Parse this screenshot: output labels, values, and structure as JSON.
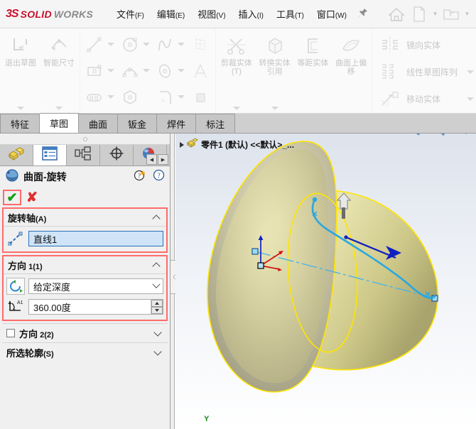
{
  "app": {
    "brand_3ds": "3S",
    "brand_solid": "SOLID",
    "brand_works": "WORKS",
    "accent_red": "#c8102e"
  },
  "menubar": {
    "items": [
      {
        "label": "文件",
        "mnemonic": "(F)",
        "name": "menu-file"
      },
      {
        "label": "编辑",
        "mnemonic": "(E)",
        "name": "menu-edit"
      },
      {
        "label": "视图",
        "mnemonic": "(V)",
        "name": "menu-view"
      },
      {
        "label": "插入",
        "mnemonic": "(I)",
        "name": "menu-insert"
      },
      {
        "label": "工具",
        "mnemonic": "(T)",
        "name": "menu-tools"
      },
      {
        "label": "窗口",
        "mnemonic": "(W)",
        "name": "menu-window"
      }
    ],
    "pin_icon": "pin-icon",
    "quick_access": [
      {
        "icon": "home-icon",
        "caret": false
      },
      {
        "icon": "new-document-icon",
        "caret": true
      },
      {
        "icon": "open-folder-icon",
        "caret": true
      },
      {
        "icon": "save-icon",
        "caret": false
      }
    ]
  },
  "ribbon": {
    "groups": [
      {
        "name": "sketch-exit-group",
        "big_buttons": [
          {
            "icon": "exit-sketch-icon",
            "label": "退出草图",
            "caret": true
          },
          {
            "icon": "smart-dimension-icon",
            "label": "智能尺寸",
            "caret": true
          }
        ]
      },
      {
        "name": "sketch-entities-group",
        "small_items": [
          {
            "icon": "line-icon",
            "caret": true
          },
          {
            "icon": "circle-icon",
            "caret": true
          },
          {
            "icon": "spline-icon",
            "caret": true
          },
          {
            "icon": "grid-snap-icon",
            "caret": false
          },
          {
            "icon": "rectangle-icon",
            "caret": true
          },
          {
            "icon": "arc-icon",
            "caret": true
          },
          {
            "icon": "ellipse-icon",
            "caret": true
          },
          {
            "icon": "text-icon",
            "caret": false
          },
          {
            "icon": "slot-icon",
            "caret": true
          },
          {
            "icon": "polygon-icon",
            "caret": false
          },
          {
            "icon": "sketch-fillet-icon",
            "caret": true
          },
          {
            "icon": "shaded-area-icon",
            "caret": false
          }
        ]
      },
      {
        "name": "sketch-tools-group",
        "big_buttons": [
          {
            "icon": "trim-entities-icon",
            "label": "剪裁实体(T)",
            "caret": true
          },
          {
            "icon": "convert-entities-icon",
            "label": "转换实体引用",
            "caret": true
          },
          {
            "icon": "offset-entities-icon",
            "label": "等距实体",
            "caret": false
          },
          {
            "icon": "offset-on-surface-icon",
            "label": "曲面上偏移",
            "caret": false
          }
        ]
      },
      {
        "name": "sketch-pattern-group",
        "list_items": [
          {
            "icon": "mirror-entities-icon",
            "label": "镜向实体",
            "caret": false
          },
          {
            "icon": "linear-sketch-pattern-icon",
            "label": "线性草图阵列",
            "caret": true
          },
          {
            "icon": "move-entities-icon",
            "label": "移动实体",
            "caret": true
          }
        ]
      }
    ]
  },
  "tabs": {
    "items": [
      {
        "label": "特征",
        "active": false,
        "name": "tab-features"
      },
      {
        "label": "草图",
        "active": true,
        "name": "tab-sketch"
      },
      {
        "label": "曲面",
        "active": false,
        "name": "tab-surfaces"
      },
      {
        "label": "钣金",
        "active": false,
        "name": "tab-sheetmetal"
      },
      {
        "label": "焊件",
        "active": false,
        "name": "tab-weldments"
      },
      {
        "label": "标注",
        "active": false,
        "name": "tab-annotation"
      }
    ]
  },
  "property_manager": {
    "panel_tabs": [
      {
        "icon": "feature-tree-icon",
        "active": false,
        "name": "panel-tab-feature-manager"
      },
      {
        "icon": "property-list-icon",
        "active": true,
        "name": "panel-tab-property-manager"
      },
      {
        "icon": "configuration-icon",
        "active": false,
        "name": "panel-tab-configuration-manager"
      },
      {
        "icon": "dimxpert-icon",
        "active": false,
        "name": "panel-tab-dimxpert"
      },
      {
        "icon": "appearances-sphere-icon",
        "active": false,
        "name": "panel-tab-appearances"
      }
    ],
    "nav_prev": "◀",
    "nav_next": "▶",
    "title": "曲面-旋转",
    "title_icon": "revolve-surface-icon",
    "help_whatsnew_icon": "help-whatsnew-icon",
    "help_icon": "help-icon",
    "confirm_icon": "check-icon",
    "cancel_icon": "x-icon",
    "groups": [
      {
        "name": "axis-of-revolution-group",
        "title": "旋转轴",
        "title_suffix": "(A)",
        "highlighted": true,
        "collapsed": false,
        "field_icon": "axis-line-icon",
        "field_value": "直线1"
      },
      {
        "name": "direction1-group",
        "title": "方向",
        "title_suffix": " 1(1)",
        "highlighted": true,
        "collapsed": false,
        "end_condition_icon": "revolve-direction-icon",
        "end_condition_value": "给定深度",
        "angle_icon": "angle-a1-icon",
        "angle_value": "360.00度"
      }
    ],
    "direction2": {
      "name": "direction2-group",
      "title": "方向",
      "title_suffix": " 2(2)",
      "checked": false,
      "collapsed": true
    },
    "selected_contours": {
      "name": "selected-contours-group",
      "title": "所选轮廓",
      "title_suffix": "(S)",
      "collapsed": true
    }
  },
  "graphics": {
    "tree_item": "零件1 (默认) <<默认>_...",
    "tree_icon": "part-icon",
    "view_tools": [
      {
        "icon": "zoom-to-fit-icon",
        "name": "zoom-to-fit-button"
      },
      {
        "icon": "zoom-to-area-icon",
        "name": "zoom-to-area-button"
      },
      {
        "icon": "section-view-icon",
        "name": "section-view-button"
      }
    ],
    "triad_label_y": "Y",
    "model": {
      "name": "revolved-bell-surface",
      "body_color": "#cfc98a",
      "outline_color": "#ffe400",
      "sketch_curve_color": "#29a8e0",
      "axis_color": "#4bb4e8",
      "arrow_color": "#1020c0"
    }
  }
}
